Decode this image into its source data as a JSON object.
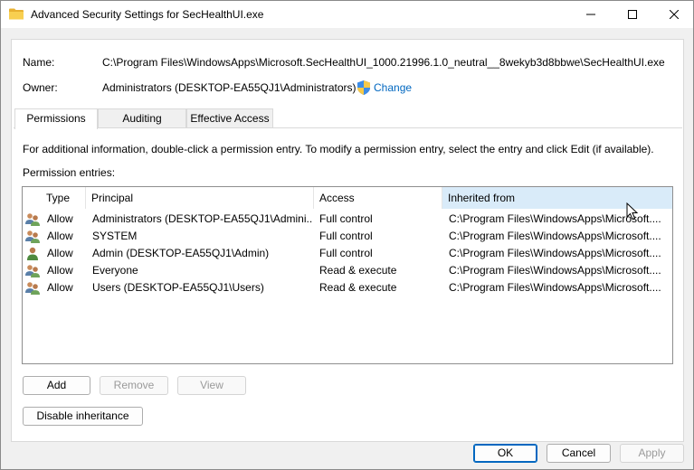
{
  "window": {
    "title": "Advanced Security Settings for SecHealthUI.exe"
  },
  "fields": {
    "name_label": "Name:",
    "name_value": "C:\\Program Files\\WindowsApps\\Microsoft.SecHealthUI_1000.21996.1.0_neutral__8wekyb3d8bbwe\\SecHealthUI.exe",
    "owner_label": "Owner:",
    "owner_value": "Administrators (DESKTOP-EA55QJ1\\Administrators)",
    "change_link": "Change"
  },
  "tabs": [
    {
      "label": "Permissions",
      "active": true
    },
    {
      "label": "Auditing",
      "active": false
    },
    {
      "label": "Effective Access",
      "active": false
    }
  ],
  "info_text": "For additional information, double-click a permission entry. To modify a permission entry, select the entry and click Edit (if available).",
  "entries_label": "Permission entries:",
  "table": {
    "columns": [
      "Type",
      "Principal",
      "Access",
      "Inherited from"
    ],
    "rows": [
      {
        "icon": "group-users-icon",
        "type": "Allow",
        "principal": "Administrators (DESKTOP-EA55QJ1\\Admini...",
        "access": "Full control",
        "inherited": "C:\\Program Files\\WindowsApps\\Microsoft...."
      },
      {
        "icon": "group-users-icon",
        "type": "Allow",
        "principal": "SYSTEM",
        "access": "Full control",
        "inherited": "C:\\Program Files\\WindowsApps\\Microsoft...."
      },
      {
        "icon": "single-user-icon",
        "type": "Allow",
        "principal": "Admin (DESKTOP-EA55QJ1\\Admin)",
        "access": "Full control",
        "inherited": "C:\\Program Files\\WindowsApps\\Microsoft...."
      },
      {
        "icon": "group-users-icon",
        "type": "Allow",
        "principal": "Everyone",
        "access": "Read & execute",
        "inherited": "C:\\Program Files\\WindowsApps\\Microsoft...."
      },
      {
        "icon": "group-users-icon",
        "type": "Allow",
        "principal": "Users (DESKTOP-EA55QJ1\\Users)",
        "access": "Read & execute",
        "inherited": "C:\\Program Files\\WindowsApps\\Microsoft...."
      }
    ]
  },
  "buttons": {
    "add": "Add",
    "remove": "Remove",
    "view": "View",
    "disable_inheritance": "Disable inheritance",
    "ok": "OK",
    "cancel": "Cancel",
    "apply": "Apply"
  },
  "colors": {
    "link": "#0067c0",
    "header_hover": "#d9ebf9",
    "folder": "#f5c342"
  }
}
